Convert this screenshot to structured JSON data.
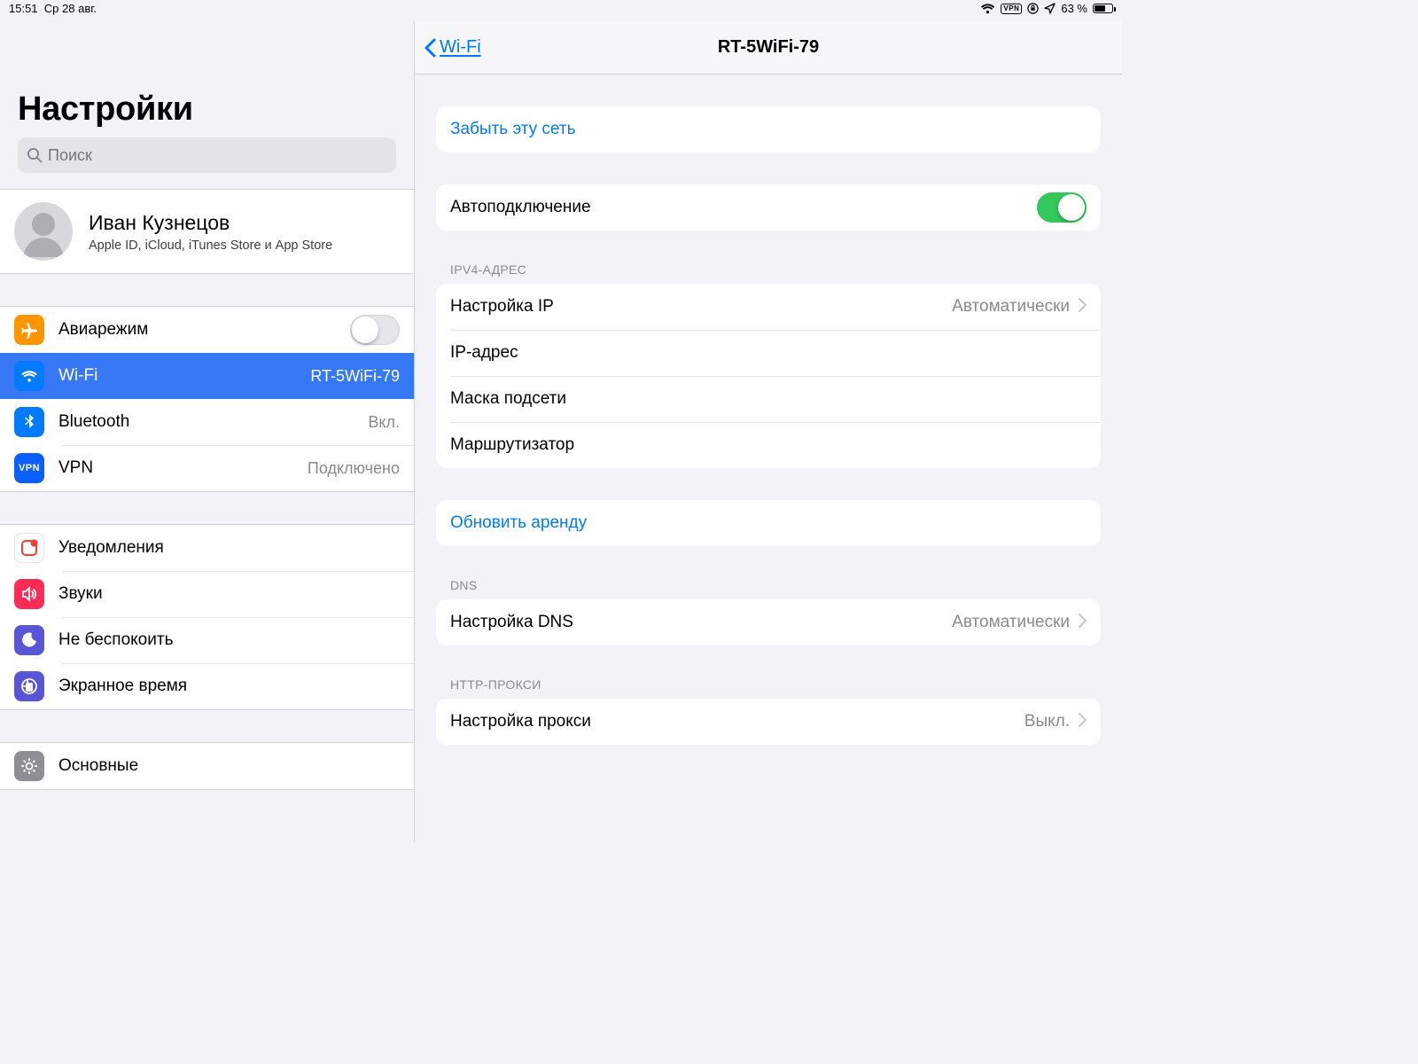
{
  "status": {
    "time": "15:51",
    "date": "Ср 28 авг.",
    "vpn_label": "VPN",
    "battery_pct": "63 %",
    "battery_fill_pct": 63
  },
  "sidebar": {
    "title": "Настройки",
    "search_placeholder": "Поиск",
    "apple_id": {
      "name": "Иван Кузнецов",
      "subtitle": "Apple ID, iCloud, iTunes Store и App Store"
    },
    "items_net": [
      {
        "icon": "airplane-icon",
        "label": "Авиарежим",
        "kind": "toggle",
        "on": false
      },
      {
        "icon": "wifi-icon",
        "label": "Wi-Fi",
        "detail": "RT-5WiFi-79",
        "selected": true
      },
      {
        "icon": "bluetooth-icon",
        "label": "Bluetooth",
        "detail": "Вкл."
      },
      {
        "icon": "vpn-icon",
        "label": "VPN",
        "detail": "Подключено"
      }
    ],
    "items_notif": [
      {
        "icon": "notifications-icon",
        "label": "Уведомления"
      },
      {
        "icon": "sounds-icon",
        "label": "Звуки"
      },
      {
        "icon": "dnd-icon",
        "label": "Не беспокоить"
      },
      {
        "icon": "screentime-icon",
        "label": "Экранное время"
      }
    ],
    "items_general": [
      {
        "icon": "general-icon",
        "label": "Основные"
      }
    ]
  },
  "detail": {
    "back_label": "Wi-Fi",
    "title": "RT-5WiFi-79",
    "forget_label": "Забыть эту сеть",
    "autojoin_label": "Автоподключение",
    "autojoin_on": true,
    "ipv4_header": "IPV4-АДРЕС",
    "ip_config": {
      "label": "Настройка IP",
      "value": "Автоматически"
    },
    "ip_addr": {
      "label": "IP-адрес"
    },
    "subnet": {
      "label": "Маска подсети"
    },
    "router": {
      "label": "Маршрутизатор"
    },
    "renew_label": "Обновить аренду",
    "dns_header": "DNS",
    "dns_config": {
      "label": "Настройка DNS",
      "value": "Автоматически"
    },
    "proxy_header": "HTTP-ПРОКСИ",
    "proxy_config": {
      "label": "Настройка прокси",
      "value": "Выкл."
    }
  }
}
